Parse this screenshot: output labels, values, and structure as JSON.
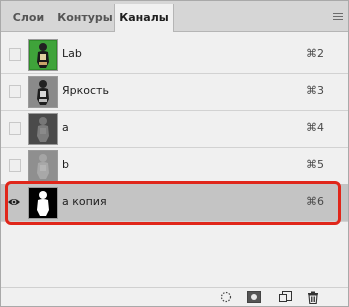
{
  "tabs": [
    {
      "label": "Слои"
    },
    {
      "label": "Контуры"
    },
    {
      "label": "Каналы"
    }
  ],
  "channels": [
    {
      "name": "Lab",
      "shortcut": "⌘2"
    },
    {
      "name": "Яркость",
      "shortcut": "⌘3"
    },
    {
      "name": "a",
      "shortcut": "⌘4"
    },
    {
      "name": "b",
      "shortcut": "⌘5"
    },
    {
      "name": "a копия",
      "shortcut": "⌘6"
    }
  ],
  "colors": {
    "selection_highlight": "#e0261a",
    "selected_row": "#c4c4c4"
  },
  "icons": {
    "panel_menu": "hamburger-menu-icon",
    "visibility": "eye-icon",
    "load_selection": "dotted-circle-icon",
    "save_selection": "mask-icon",
    "new_channel": "new-channel-icon",
    "delete": "trash-icon"
  }
}
